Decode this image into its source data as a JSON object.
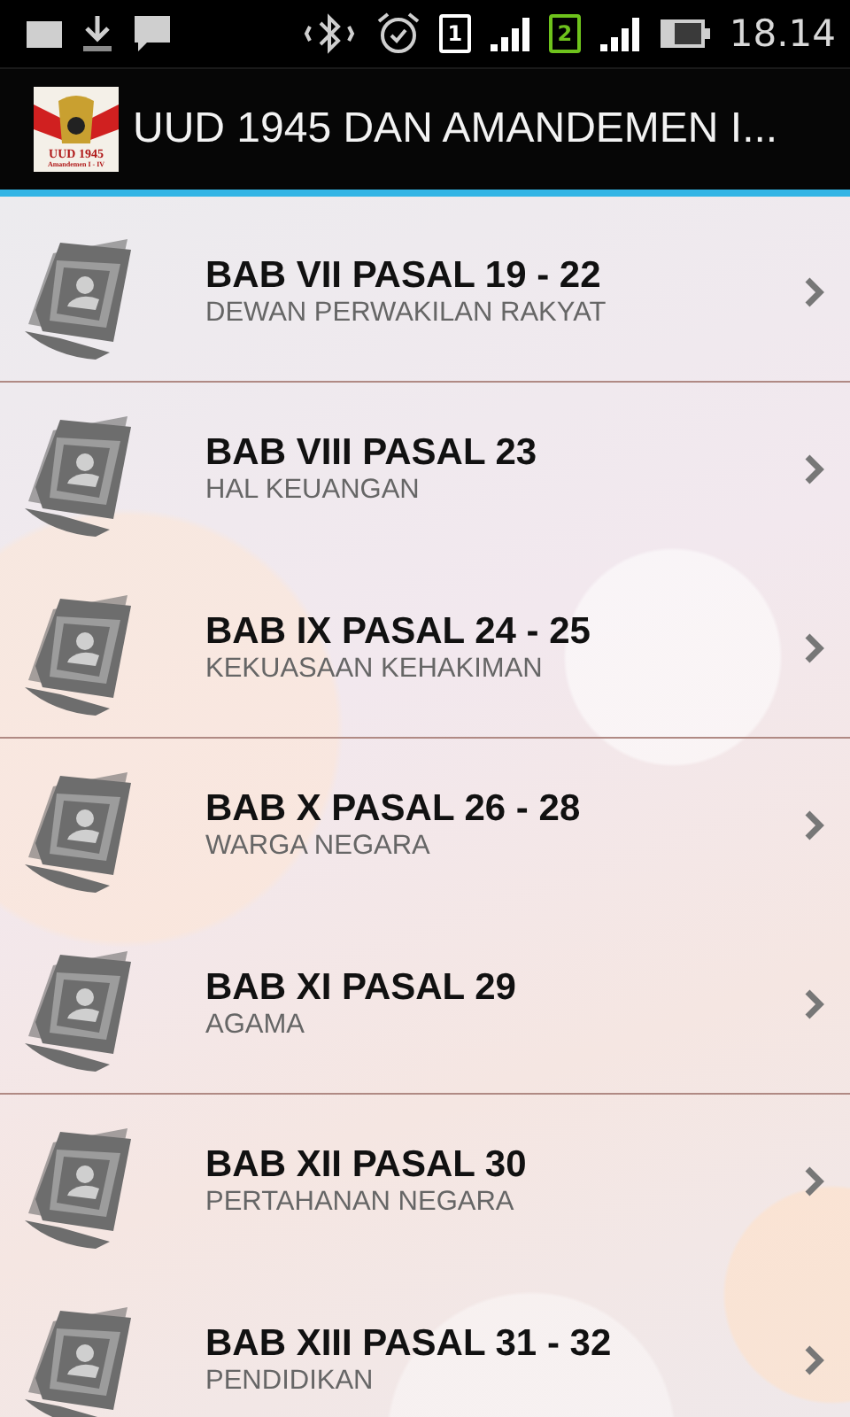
{
  "status_bar": {
    "sims": [
      {
        "label": "1",
        "active": false
      },
      {
        "label": "2",
        "active": true
      }
    ],
    "time": "18.14"
  },
  "action_bar": {
    "logo": {
      "title": "UUD 1945",
      "subtitle": "Amandemen I - IV"
    },
    "title": "UUD 1945 DAN AMANDEMEN I..."
  },
  "items": [
    {
      "title": "BAB VII PASAL 19 - 22",
      "subtitle": "DEWAN PERWAKILAN RAKYAT",
      "divider_below": true
    },
    {
      "title": "BAB VIII PASAL 23",
      "subtitle": "HAL KEUANGAN",
      "divider_below": false
    },
    {
      "title": "BAB IX PASAL 24 - 25",
      "subtitle": "KEKUASAAN KEHAKIMAN",
      "divider_below": true
    },
    {
      "title": "BAB X PASAL 26 - 28",
      "subtitle": "WARGA NEGARA",
      "divider_below": false
    },
    {
      "title": "BAB XI PASAL 29",
      "subtitle": "AGAMA",
      "divider_below": true
    },
    {
      "title": "BAB XII PASAL 30",
      "subtitle": "PERTAHANAN NEGARA",
      "divider_below": false
    },
    {
      "title": "BAB XIII PASAL 31 - 32",
      "subtitle": "PENDIDIKAN"
    }
  ]
}
